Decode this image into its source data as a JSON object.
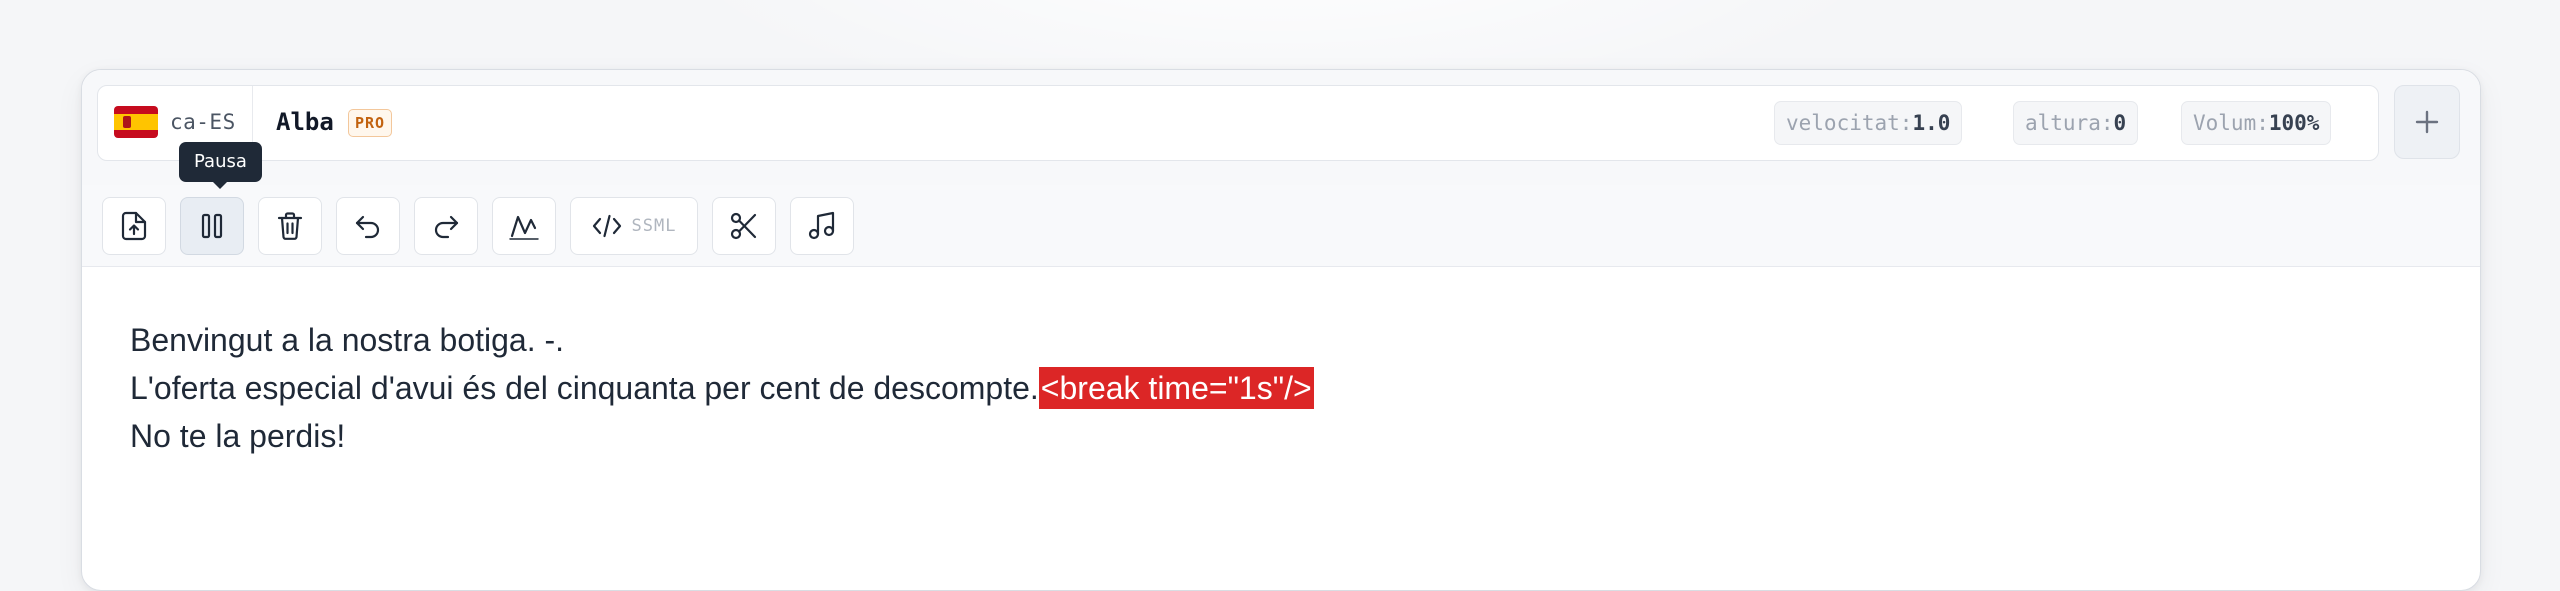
{
  "voice": {
    "flag_icon": "spain-flag-icon",
    "lang_code": "ca-ES",
    "name": "Alba",
    "badge": "PRO"
  },
  "params": [
    {
      "key": "velocitat:",
      "value": "1.0"
    },
    {
      "key": "altura:",
      "value": "0"
    },
    {
      "key": "Volum:",
      "value": "100%"
    }
  ],
  "add_button": {
    "icon": "plus-icon"
  },
  "toolbar": {
    "buttons": [
      {
        "name": "upload-button",
        "icon": "file-upload-icon"
      },
      {
        "name": "pause-button",
        "icon": "pause-icon",
        "active": true
      },
      {
        "name": "delete-button",
        "icon": "trash-icon"
      },
      {
        "name": "undo-button",
        "icon": "undo-icon"
      },
      {
        "name": "redo-button",
        "icon": "redo-icon"
      },
      {
        "name": "waveform-button",
        "icon": "waveform-icon"
      },
      {
        "name": "ssml-button",
        "icon": "code-icon",
        "label": "SSML"
      },
      {
        "name": "cut-button",
        "icon": "scissors-icon"
      },
      {
        "name": "music-button",
        "icon": "music-note-icon"
      }
    ],
    "tooltip": "Pausa"
  },
  "content": {
    "line1": "Benvingut a la nostra botiga. -.",
    "line2": "L'oferta especial d'avui és del cinquanta per cent de descompte.",
    "line2_tag": "<break time=\"1s\"/>",
    "line3": "No te la perdis!"
  },
  "colors": {
    "accent_break": "#dc2626",
    "pro_badge": "#c2620f",
    "tooltip_bg": "#1f2937"
  }
}
